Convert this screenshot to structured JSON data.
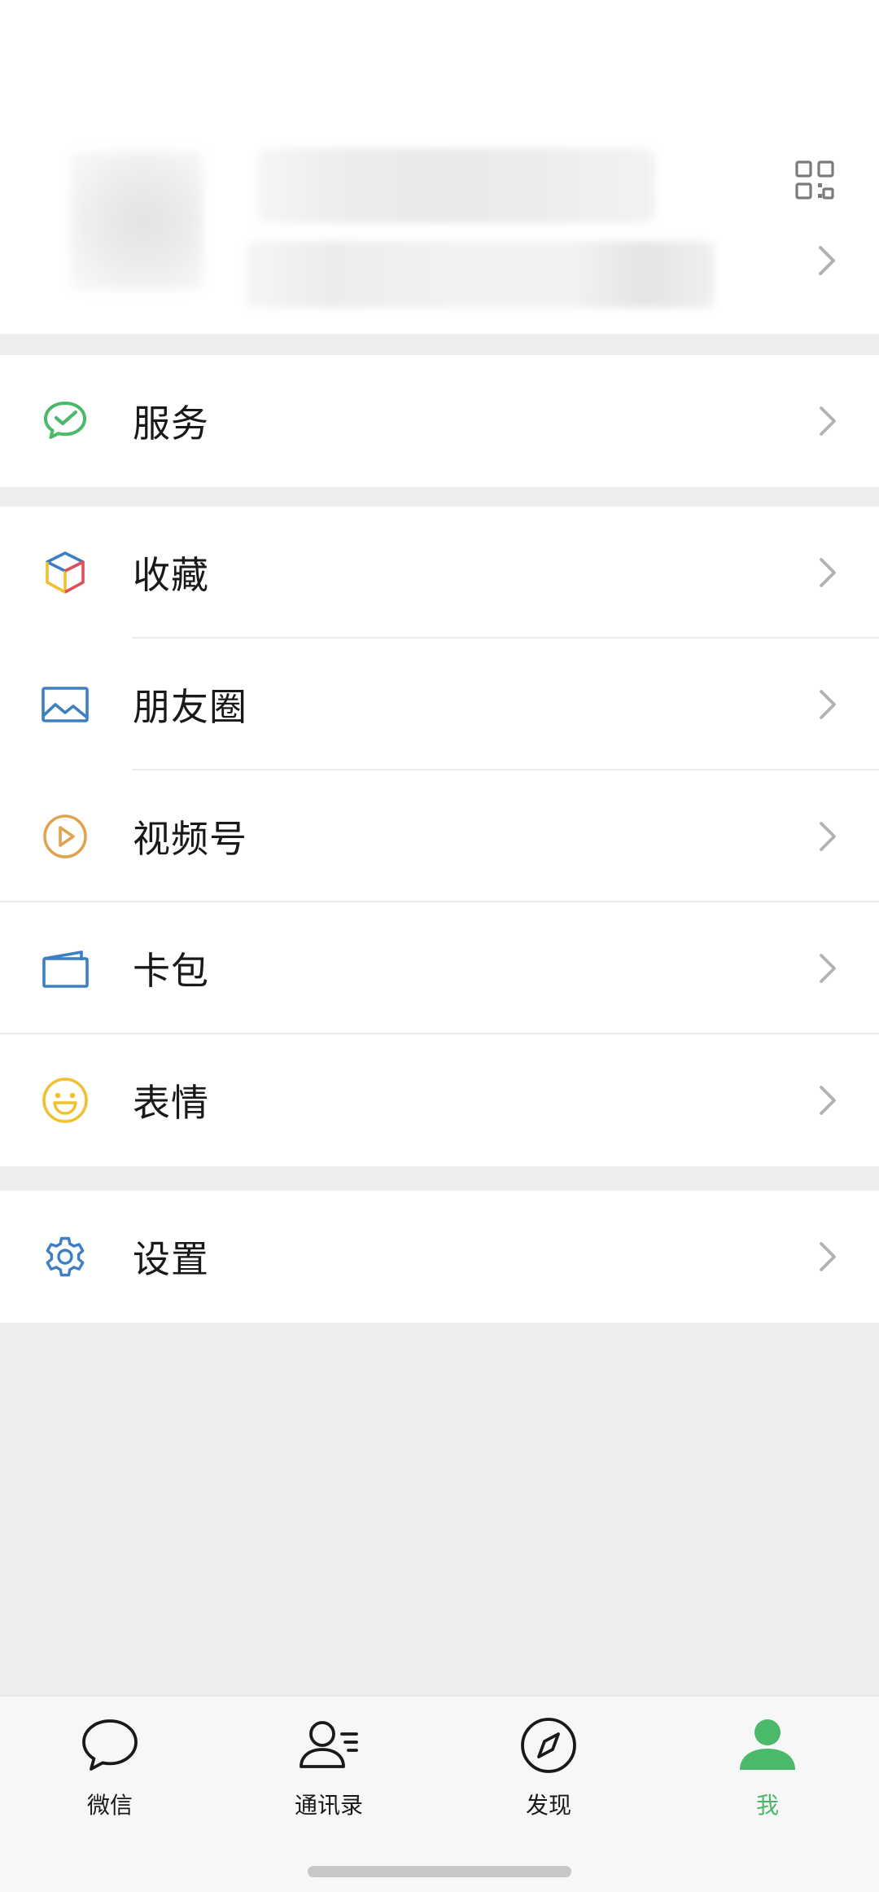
{
  "menu": {
    "groups": [
      {
        "items": [
          {
            "label": "服务",
            "icon": "wechat-pay-icon",
            "color": "#4bb96a"
          }
        ]
      },
      {
        "items": [
          {
            "label": "收藏",
            "icon": "favorites-cube-icon"
          },
          {
            "label": "朋友圈",
            "icon": "moments-image-icon",
            "color": "#3d7fc0"
          },
          {
            "label": "视频号",
            "icon": "channels-play-icon",
            "color": "#e0a352"
          },
          {
            "label": "卡包",
            "icon": "card-wallet-icon",
            "color": "#3d7fc0"
          },
          {
            "label": "表情",
            "icon": "sticker-smile-icon",
            "color": "#f0c02f"
          }
        ]
      },
      {
        "items": [
          {
            "label": "设置",
            "icon": "settings-gear-icon",
            "color": "#3d7fc0"
          }
        ]
      }
    ]
  },
  "tabbar": {
    "tabs": [
      {
        "label": "微信",
        "icon": "chat-bubble-icon",
        "active": false
      },
      {
        "label": "通讯录",
        "icon": "contacts-icon",
        "active": false
      },
      {
        "label": "发现",
        "icon": "compass-icon",
        "active": false
      },
      {
        "label": "我",
        "icon": "person-icon",
        "active": true
      }
    ],
    "active_color": "#4bb96a"
  }
}
